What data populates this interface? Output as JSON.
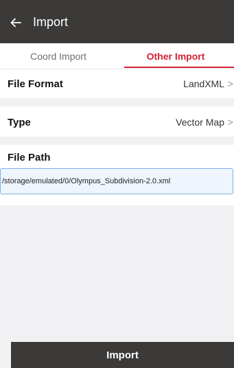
{
  "header": {
    "title": "Import",
    "back_icon": "arrow-left-icon"
  },
  "tabs": [
    {
      "label": "Coord Import",
      "active": false
    },
    {
      "label": "Other Import",
      "active": true
    }
  ],
  "file_format": {
    "label": "File Format",
    "value": "LandXML",
    "chevron": ">"
  },
  "type": {
    "label": "Type",
    "value": "Vector Map",
    "chevron": ">"
  },
  "file_path": {
    "label": "File Path",
    "value": "/storage/emulated/0/Olympus_Subdivision-2.0.xml"
  },
  "import_button": {
    "label": "Import"
  },
  "colors": {
    "header_bg": "#3b3a39",
    "accent": "#d31f36",
    "page_bg": "#f1f1f3"
  }
}
